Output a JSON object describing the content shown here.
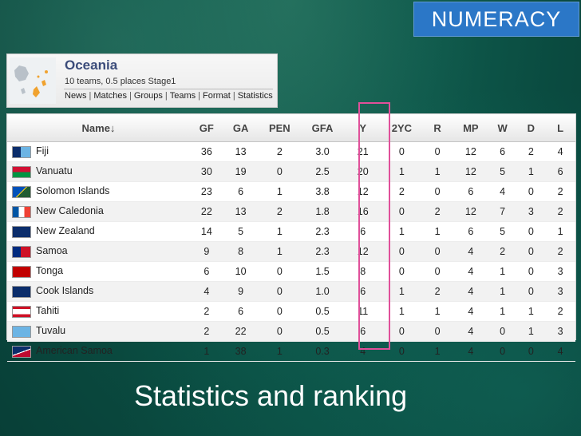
{
  "badge": {
    "label": "NUMERACY"
  },
  "header": {
    "region": "Oceania",
    "subtitle": "10 teams, 0.5 places Stage1",
    "links": [
      "News",
      "Matches",
      "Groups",
      "Teams",
      "Format",
      "Statistics"
    ]
  },
  "table": {
    "columns": [
      "Name↓",
      "GF",
      "GA",
      "PEN",
      "GFA",
      "Y",
      "2YC",
      "R",
      "MP",
      "W",
      "D",
      "L"
    ],
    "rows": [
      {
        "name": "Fiji",
        "flag": "fiji-flag",
        "GF": "36",
        "GA": "13",
        "PEN": "2",
        "GFA": "3.0",
        "Y": "21",
        "2YC": "0",
        "R": "0",
        "MP": "12",
        "W": "6",
        "D": "2",
        "L": "4"
      },
      {
        "name": "Vanuatu",
        "flag": "vanuatu-flag",
        "GF": "30",
        "GA": "19",
        "PEN": "0",
        "GFA": "2.5",
        "Y": "20",
        "2YC": "1",
        "R": "1",
        "MP": "12",
        "W": "5",
        "D": "1",
        "L": "6"
      },
      {
        "name": "Solomon Islands",
        "flag": "solomon-islands-flag",
        "GF": "23",
        "GA": "6",
        "PEN": "1",
        "GFA": "3.8",
        "Y": "12",
        "2YC": "2",
        "R": "0",
        "MP": "6",
        "W": "4",
        "D": "0",
        "L": "2"
      },
      {
        "name": "New Caledonia",
        "flag": "new-caledonia-flag",
        "GF": "22",
        "GA": "13",
        "PEN": "2",
        "GFA": "1.8",
        "Y": "16",
        "2YC": "0",
        "R": "2",
        "MP": "12",
        "W": "7",
        "D": "3",
        "L": "2"
      },
      {
        "name": "New Zealand",
        "flag": "new-zealand-flag",
        "GF": "14",
        "GA": "5",
        "PEN": "1",
        "GFA": "2.3",
        "Y": "6",
        "2YC": "1",
        "R": "1",
        "MP": "6",
        "W": "5",
        "D": "0",
        "L": "1"
      },
      {
        "name": "Samoa",
        "flag": "samoa-flag",
        "GF": "9",
        "GA": "8",
        "PEN": "1",
        "GFA": "2.3",
        "Y": "12",
        "2YC": "0",
        "R": "0",
        "MP": "4",
        "W": "2",
        "D": "0",
        "L": "2"
      },
      {
        "name": "Tonga",
        "flag": "tonga-flag",
        "GF": "6",
        "GA": "10",
        "PEN": "0",
        "GFA": "1.5",
        "Y": "8",
        "2YC": "0",
        "R": "0",
        "MP": "4",
        "W": "1",
        "D": "0",
        "L": "3"
      },
      {
        "name": "Cook Islands",
        "flag": "cook-islands-flag",
        "GF": "4",
        "GA": "9",
        "PEN": "0",
        "GFA": "1.0",
        "Y": "6",
        "2YC": "1",
        "R": "2",
        "MP": "4",
        "W": "1",
        "D": "0",
        "L": "3"
      },
      {
        "name": "Tahiti",
        "flag": "tahiti-flag",
        "GF": "2",
        "GA": "6",
        "PEN": "0",
        "GFA": "0.5",
        "Y": "11",
        "2YC": "1",
        "R": "1",
        "MP": "4",
        "W": "1",
        "D": "1",
        "L": "2"
      },
      {
        "name": "Tuvalu",
        "flag": "tuvalu-flag",
        "GF": "2",
        "GA": "22",
        "PEN": "0",
        "GFA": "0.5",
        "Y": "6",
        "2YC": "0",
        "R": "0",
        "MP": "4",
        "W": "0",
        "D": "1",
        "L": "3"
      },
      {
        "name": "American Samoa",
        "flag": "american-samoa-flag",
        "GF": "1",
        "GA": "38",
        "PEN": "1",
        "GFA": "0.3",
        "Y": "4",
        "2YC": "0",
        "R": "1",
        "MP": "4",
        "W": "0",
        "D": "0",
        "L": "4"
      }
    ]
  },
  "footer": {
    "title": "Statistics and ranking"
  }
}
